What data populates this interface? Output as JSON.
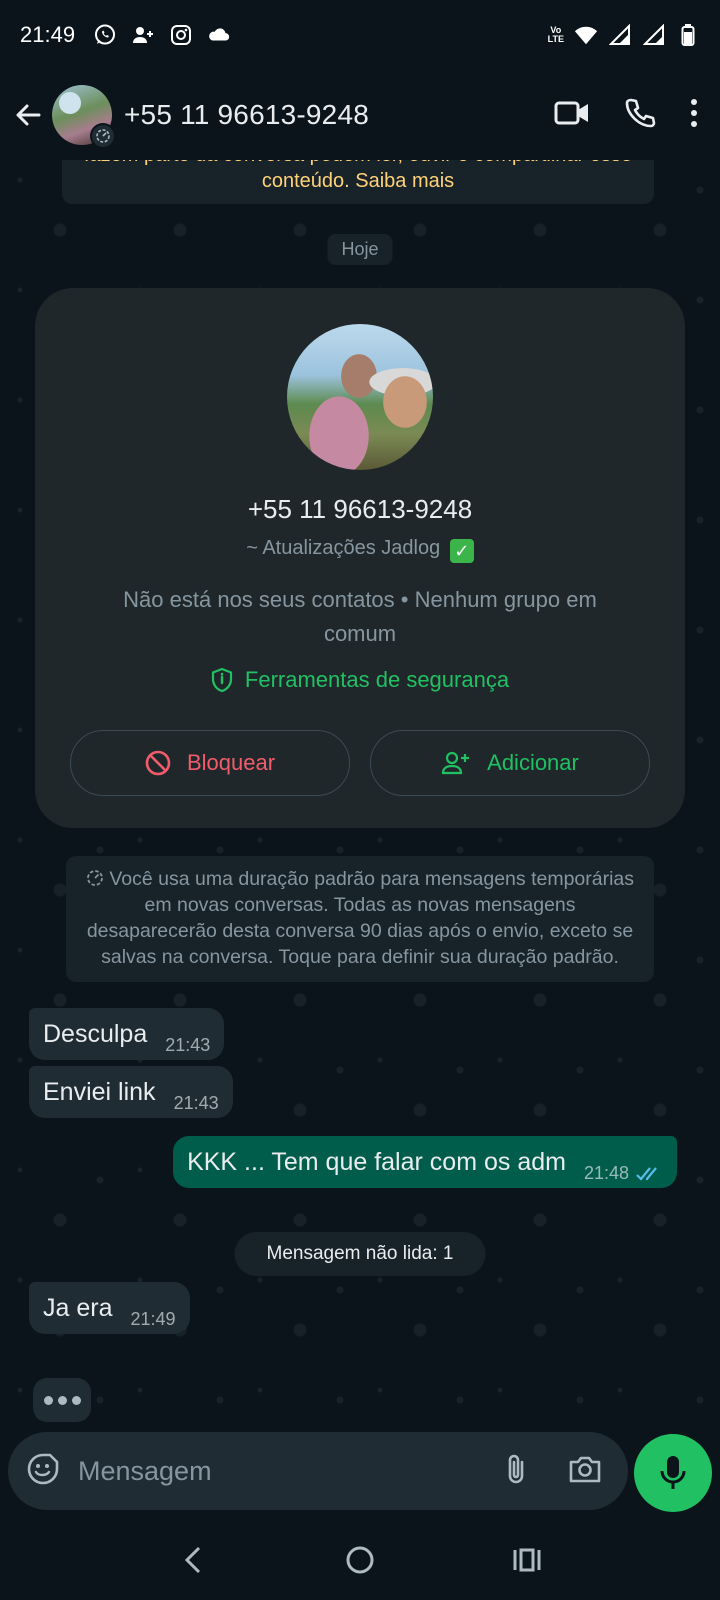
{
  "status_bar": {
    "time": "21:49",
    "left_icons": [
      "whatsapp-icon",
      "add-contact-icon",
      "instagram-icon",
      "cloud-icon"
    ],
    "right_icons": [
      "volte-icon",
      "wifi-icon",
      "signal-icon",
      "signal-icon",
      "battery-icon"
    ],
    "volte_top": "Vo",
    "volte_bottom": "LTE"
  },
  "header": {
    "title": "+55 11 96613-9248",
    "actions": [
      "video-call-icon",
      "voice-call-icon",
      "more-options-icon"
    ]
  },
  "encryption_notice": {
    "text": "fazem parte da conversa podem ler, ouvir e compartilhar esse conteúdo. Saiba mais"
  },
  "date_chip": "Hoje",
  "profile_card": {
    "number": "+55 11 96613-9248",
    "name": "~ Atualizações Jadlog",
    "name_badge": "✓",
    "subtitle": "Não está nos seus contatos • Nenhum grupo em comum",
    "security_label": "Ferramentas de segurança",
    "block_label": "Bloquear",
    "add_label": "Adicionar"
  },
  "timer_notice": {
    "text": "Você usa uma duração padrão para mensagens temporárias em novas conversas. Todas as novas mensagens desaparecerão desta conversa 90 dias após o envio, exceto se salvas na conversa. Toque para definir sua duração padrão."
  },
  "messages": [
    {
      "direction": "in",
      "text": "Desculpa",
      "time": "21:43"
    },
    {
      "direction": "in",
      "text": "Enviei link",
      "time": "21:43"
    },
    {
      "direction": "out",
      "text": "KKK ... Tem que falar com os adm",
      "time": "21:48",
      "status": "read"
    },
    {
      "direction": "in",
      "text": "Ja era",
      "time": "21:49"
    }
  ],
  "unread_chip": "Mensagem não lida: 1",
  "input": {
    "placeholder": "Mensagem"
  },
  "colors": {
    "background": "#0b141a",
    "incoming_bubble": "#1f2c34",
    "outgoing_bubble": "#005c4b",
    "accent_green": "#21c063",
    "danger_red": "#f15c6d",
    "notice_yellow": "#ffd279",
    "read_ticks": "#53bdeb"
  }
}
